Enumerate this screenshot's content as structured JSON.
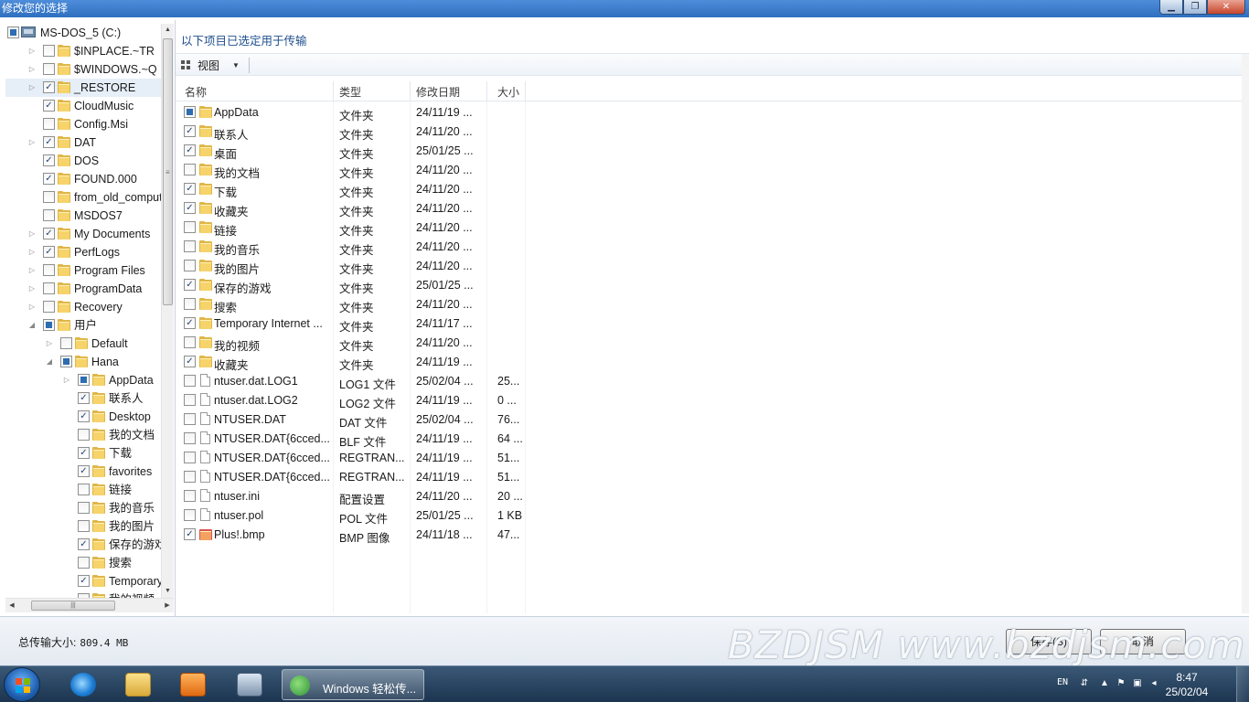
{
  "window": {
    "title": "修改您的选择"
  },
  "tree": {
    "items": [
      {
        "label": "MS-DOS_5 (C:)",
        "indent": 0,
        "arrow": "none",
        "check": "partial",
        "icon": "drive"
      },
      {
        "label": "$INPLACE.~TR",
        "indent": 1,
        "arrow": "collapsed",
        "check": "unchecked",
        "icon": "folder"
      },
      {
        "label": "$WINDOWS.~Q",
        "indent": 1,
        "arrow": "collapsed",
        "check": "unchecked",
        "icon": "folder"
      },
      {
        "label": "_RESTORE",
        "indent": 1,
        "arrow": "collapsed",
        "check": "checked",
        "icon": "folder",
        "selected": true
      },
      {
        "label": "CloudMusic",
        "indent": 1,
        "arrow": "none",
        "check": "checked",
        "icon": "folder"
      },
      {
        "label": "Config.Msi",
        "indent": 1,
        "arrow": "none",
        "check": "unchecked",
        "icon": "folder"
      },
      {
        "label": "DAT",
        "indent": 1,
        "arrow": "collapsed",
        "check": "checked",
        "icon": "folder"
      },
      {
        "label": "DOS",
        "indent": 1,
        "arrow": "none",
        "check": "checked",
        "icon": "folder"
      },
      {
        "label": "FOUND.000",
        "indent": 1,
        "arrow": "none",
        "check": "checked",
        "icon": "folder"
      },
      {
        "label": "from_old_computer",
        "indent": 1,
        "arrow": "none",
        "check": "unchecked",
        "icon": "folder"
      },
      {
        "label": "MSDOS7",
        "indent": 1,
        "arrow": "none",
        "check": "unchecked",
        "icon": "folder"
      },
      {
        "label": "My Documents",
        "indent": 1,
        "arrow": "collapsed",
        "check": "checked",
        "icon": "folder"
      },
      {
        "label": "PerfLogs",
        "indent": 1,
        "arrow": "collapsed",
        "check": "checked",
        "icon": "folder"
      },
      {
        "label": "Program Files",
        "indent": 1,
        "arrow": "collapsed",
        "check": "unchecked",
        "icon": "folder"
      },
      {
        "label": "ProgramData",
        "indent": 1,
        "arrow": "collapsed",
        "check": "unchecked",
        "icon": "folder"
      },
      {
        "label": "Recovery",
        "indent": 1,
        "arrow": "collapsed",
        "check": "unchecked",
        "icon": "folder"
      },
      {
        "label": "用户",
        "indent": 1,
        "arrow": "expanded",
        "check": "partial",
        "icon": "folder"
      },
      {
        "label": "Default",
        "indent": 2,
        "arrow": "collapsed",
        "check": "unchecked",
        "icon": "folder"
      },
      {
        "label": "Hana",
        "indent": 2,
        "arrow": "expanded",
        "check": "partial",
        "icon": "folder"
      },
      {
        "label": "AppData",
        "indent": 3,
        "arrow": "collapsed",
        "check": "partial",
        "icon": "folder"
      },
      {
        "label": "联系人",
        "indent": 3,
        "arrow": "none",
        "check": "checked",
        "icon": "folder"
      },
      {
        "label": "Desktop",
        "indent": 3,
        "arrow": "none",
        "check": "checked",
        "icon": "folder"
      },
      {
        "label": "我的文档",
        "indent": 3,
        "arrow": "none",
        "check": "unchecked",
        "icon": "folder"
      },
      {
        "label": "下载",
        "indent": 3,
        "arrow": "none",
        "check": "checked",
        "icon": "folder"
      },
      {
        "label": "favorites",
        "indent": 3,
        "arrow": "none",
        "check": "checked",
        "icon": "folder"
      },
      {
        "label": "链接",
        "indent": 3,
        "arrow": "none",
        "check": "unchecked",
        "icon": "folder"
      },
      {
        "label": "我的音乐",
        "indent": 3,
        "arrow": "none",
        "check": "unchecked",
        "icon": "folder"
      },
      {
        "label": "我的图片",
        "indent": 3,
        "arrow": "none",
        "check": "unchecked",
        "icon": "folder"
      },
      {
        "label": "保存的游戏",
        "indent": 3,
        "arrow": "none",
        "check": "checked",
        "icon": "folder"
      },
      {
        "label": "搜索",
        "indent": 3,
        "arrow": "none",
        "check": "unchecked",
        "icon": "folder"
      },
      {
        "label": "Temporary In",
        "indent": 3,
        "arrow": "none",
        "check": "checked",
        "icon": "folder"
      },
      {
        "label": "我的视频",
        "indent": 3,
        "arrow": "none",
        "check": "unchecked",
        "icon": "folder"
      }
    ]
  },
  "main": {
    "heading": "以下项目已选定用于传输",
    "view_label": "视图",
    "columns": {
      "name": "名称",
      "type": "类型",
      "date": "修改日期",
      "size": "大小"
    },
    "rows": [
      {
        "name": "AppData",
        "type": "文件夹",
        "date": "24/11/19 ...",
        "size": "",
        "check": "partial",
        "icon": "folder"
      },
      {
        "name": "联系人",
        "type": "文件夹",
        "date": "24/11/20 ...",
        "size": "",
        "check": "checked",
        "icon": "folder"
      },
      {
        "name": "桌面",
        "type": "文件夹",
        "date": "25/01/25 ...",
        "size": "",
        "check": "checked",
        "icon": "folder"
      },
      {
        "name": "我的文档",
        "type": "文件夹",
        "date": "24/11/20 ...",
        "size": "",
        "check": "unchecked",
        "icon": "folder"
      },
      {
        "name": "下载",
        "type": "文件夹",
        "date": "24/11/20 ...",
        "size": "",
        "check": "checked",
        "icon": "folder"
      },
      {
        "name": "收藏夹",
        "type": "文件夹",
        "date": "24/11/20 ...",
        "size": "",
        "check": "checked",
        "icon": "folder"
      },
      {
        "name": "链接",
        "type": "文件夹",
        "date": "24/11/20 ...",
        "size": "",
        "check": "unchecked",
        "icon": "folder"
      },
      {
        "name": "我的音乐",
        "type": "文件夹",
        "date": "24/11/20 ...",
        "size": "",
        "check": "unchecked",
        "icon": "folder"
      },
      {
        "name": "我的图片",
        "type": "文件夹",
        "date": "24/11/20 ...",
        "size": "",
        "check": "unchecked",
        "icon": "folder"
      },
      {
        "name": "保存的游戏",
        "type": "文件夹",
        "date": "25/01/25 ...",
        "size": "",
        "check": "checked",
        "icon": "folder"
      },
      {
        "name": "搜索",
        "type": "文件夹",
        "date": "24/11/20 ...",
        "size": "",
        "check": "unchecked",
        "icon": "folder"
      },
      {
        "name": "Temporary Internet ...",
        "type": "文件夹",
        "date": "24/11/17 ...",
        "size": "",
        "check": "checked",
        "icon": "folder"
      },
      {
        "name": "我的视频",
        "type": "文件夹",
        "date": "24/11/20 ...",
        "size": "",
        "check": "unchecked",
        "icon": "folder"
      },
      {
        "name": "收藏夹",
        "type": "文件夹",
        "date": "24/11/19 ...",
        "size": "",
        "check": "checked",
        "icon": "folder"
      },
      {
        "name": "ntuser.dat.LOG1",
        "type": "LOG1 文件",
        "date": "25/02/04 ...",
        "size": "25...",
        "check": "unchecked",
        "icon": "file"
      },
      {
        "name": "ntuser.dat.LOG2",
        "type": "LOG2 文件",
        "date": "24/11/19 ...",
        "size": "0 ...",
        "check": "unchecked",
        "icon": "file"
      },
      {
        "name": "NTUSER.DAT",
        "type": "DAT 文件",
        "date": "25/02/04 ...",
        "size": "76...",
        "check": "unchecked",
        "icon": "file"
      },
      {
        "name": "NTUSER.DAT{6cced...",
        "type": "BLF 文件",
        "date": "24/11/19 ...",
        "size": "64 ...",
        "check": "unchecked",
        "icon": "file"
      },
      {
        "name": "NTUSER.DAT{6cced...",
        "type": "REGTRAN...",
        "date": "24/11/19 ...",
        "size": "51...",
        "check": "unchecked",
        "icon": "file"
      },
      {
        "name": "NTUSER.DAT{6cced...",
        "type": "REGTRAN...",
        "date": "24/11/19 ...",
        "size": "51...",
        "check": "unchecked",
        "icon": "file"
      },
      {
        "name": "ntuser.ini",
        "type": "配置设置",
        "date": "24/11/20 ...",
        "size": "20 ...",
        "check": "unchecked",
        "icon": "file"
      },
      {
        "name": "ntuser.pol",
        "type": "POL 文件",
        "date": "25/01/25 ...",
        "size": "1 KB",
        "check": "unchecked",
        "icon": "file"
      },
      {
        "name": "Plus!.bmp",
        "type": "BMP 图像",
        "date": "24/11/18 ...",
        "size": "47...",
        "check": "checked",
        "icon": "image"
      }
    ]
  },
  "footer": {
    "total_label": "总传输大小:",
    "total_value": "809.4 MB",
    "save_label": "保存(S)",
    "cancel_label": "取消",
    "watermark": "BZDJSM www.bzdjsm.com"
  },
  "taskbar": {
    "active_item": "Windows 轻松传...",
    "lang": "EN",
    "time": "8:47",
    "date": "25/02/04"
  }
}
